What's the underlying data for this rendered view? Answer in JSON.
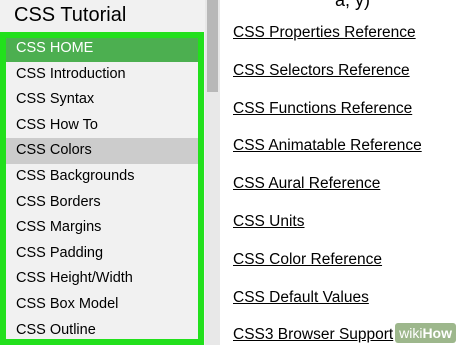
{
  "sidebar": {
    "title": "CSS Tutorial",
    "items": [
      {
        "label": "CSS HOME",
        "state": "active"
      },
      {
        "label": "CSS Introduction",
        "state": ""
      },
      {
        "label": "CSS Syntax",
        "state": ""
      },
      {
        "label": "CSS How To",
        "state": ""
      },
      {
        "label": "CSS Colors",
        "state": "hovered"
      },
      {
        "label": "CSS Backgrounds",
        "state": ""
      },
      {
        "label": "CSS Borders",
        "state": ""
      },
      {
        "label": "CSS Margins",
        "state": ""
      },
      {
        "label": "CSS Padding",
        "state": ""
      },
      {
        "label": "CSS Height/Width",
        "state": ""
      },
      {
        "label": "CSS Box Model",
        "state": ""
      },
      {
        "label": "CSS Outline",
        "state": ""
      }
    ]
  },
  "main": {
    "links": [
      "CSS Properties Reference",
      "CSS Selectors Reference",
      "CSS Functions Reference",
      "CSS Animatable Reference",
      "CSS Aural Reference",
      "CSS Units",
      "CSS Color Reference",
      "CSS Default Values",
      "CSS3 Browser Support"
    ]
  },
  "watermark": {
    "prefix": "wiki",
    "suffix": "How"
  },
  "colors": {
    "active": "#4caf50",
    "hover": "#cccccc",
    "highlight_frame": "#22e01c",
    "sidebar_bg": "#f1f1f1"
  }
}
